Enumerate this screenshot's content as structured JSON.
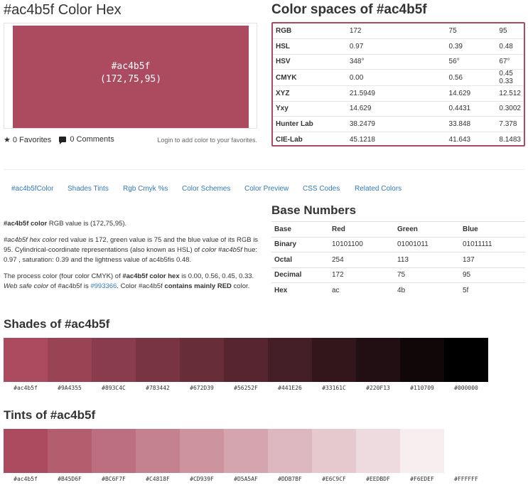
{
  "header": {
    "title": "#ac4b5f Color Hex",
    "preview_hex": "#ac4b5f",
    "preview_rgb": "(172,75,95)",
    "preview_color": "#ac4b5f"
  },
  "favorites": {
    "favorites_label": "0 Favorites",
    "comments_label": "0 Comments",
    "login_note": "Login to add color to your favorites."
  },
  "color_spaces": {
    "title": "Color spaces of #ac4b5f",
    "border_color": "#ac4b5f",
    "rows": [
      {
        "label": "RGB",
        "v1": "172",
        "v2": "75",
        "v3": "95"
      },
      {
        "label": "HSL",
        "v1": "0.97",
        "v2": "0.39",
        "v3": "0.48"
      },
      {
        "label": "HSV",
        "v1": "348°",
        "v2": "56°",
        "v3": "67°"
      },
      {
        "label": "CMYK",
        "v1": "0.00",
        "v2": "0.56",
        "v3": "0.45   0.33"
      },
      {
        "label": "XYZ",
        "v1": "21.5949",
        "v2": "14.629",
        "v3": "12.512"
      },
      {
        "label": "Yxy",
        "v1": "14.629",
        "v2": "0.4431",
        "v3": "0.3002"
      },
      {
        "label": "Hunter Lab",
        "v1": "38.2479",
        "v2": "33.848",
        "v3": "7.378"
      },
      {
        "label": "CIE-Lab",
        "v1": "45.1218",
        "v2": "41.643",
        "v3": "8.1483"
      }
    ]
  },
  "nav": {
    "items": [
      "#ac4b5fColor",
      "Shades Tints",
      "Rgb Cmyk %s",
      "Color Schemes",
      "Color Preview",
      "CSS Codes",
      "Related Colors"
    ]
  },
  "description": {
    "p1_bold": "#ac4b5f color",
    "p1_rest": " RGB value is (172,75,95).",
    "p2_italic1": "#ac4b5f hex color",
    "p2_text1": " red value is 172, green value is 75 and the blue value of its RGB is 95. Cylindrical-coordinate representations (also known as HSL) of ",
    "p2_italic2": "color #ac4b5f",
    "p2_text2": " hue: 0.97 , saturation: 0.39 and the lightness value of ac4b5fis 0.48.",
    "p3_text1": "The process color (four color CMYK) of ",
    "p3_bold1": "#ac4b5f color hex",
    "p3_text2": " is 0.00, 0.56, 0.45, 0.33. ",
    "p3_italic": "Web safe color",
    "p3_text3": " of #ac4b5f is ",
    "p3_link": "#993366",
    "p3_text4": ". Color #ac4b5f ",
    "p3_bold2": "contains mainly RED",
    "p3_text5": " color."
  },
  "base_numbers": {
    "title": "Base Numbers",
    "headers": [
      "Base",
      "Red",
      "Green",
      "Blue"
    ],
    "rows": [
      {
        "label": "Binary",
        "r": "10101100",
        "g": "01001011",
        "b": "01011111"
      },
      {
        "label": "Octal",
        "r": "254",
        "g": "113",
        "b": "137"
      },
      {
        "label": "Decimal",
        "r": "172",
        "g": "75",
        "b": "95"
      },
      {
        "label": "Hex",
        "r": "ac",
        "g": "4b",
        "b": "5f"
      }
    ]
  },
  "shades": {
    "title": "Shades of #ac4b5f",
    "items": [
      {
        "label": "#ac4b5f",
        "color": "#ac4b5f"
      },
      {
        "label": "#9A4355",
        "color": "#9A4355"
      },
      {
        "label": "#893C4C",
        "color": "#893C4C"
      },
      {
        "label": "#783442",
        "color": "#783442"
      },
      {
        "label": "#672D39",
        "color": "#672D39"
      },
      {
        "label": "#56252F",
        "color": "#56252F"
      },
      {
        "label": "#441E26",
        "color": "#441E26"
      },
      {
        "label": "#33161C",
        "color": "#33161C"
      },
      {
        "label": "#220F13",
        "color": "#220F13"
      },
      {
        "label": "#110709",
        "color": "#110709"
      },
      {
        "label": "#000000",
        "color": "#000000"
      }
    ]
  },
  "tints": {
    "title": "Tints of #ac4b5f",
    "items": [
      {
        "label": "#ac4b5f",
        "color": "#ac4b5f"
      },
      {
        "label": "#B45D6F",
        "color": "#B45D6F"
      },
      {
        "label": "#BC6F7F",
        "color": "#BC6F7F"
      },
      {
        "label": "#C4818F",
        "color": "#C4818F"
      },
      {
        "label": "#CD939F",
        "color": "#CD939F"
      },
      {
        "label": "#D5A5AF",
        "color": "#D5A5AF"
      },
      {
        "label": "#DDB7BF",
        "color": "#DDB7BF"
      },
      {
        "label": "#E6C9CF",
        "color": "#E6C9CF"
      },
      {
        "label": "#EEDBDF",
        "color": "#EEDBDF"
      },
      {
        "label": "#F6EDEF",
        "color": "#F6EDEF"
      },
      {
        "label": "#FFFFFF",
        "color": "#FFFFFF"
      }
    ]
  }
}
